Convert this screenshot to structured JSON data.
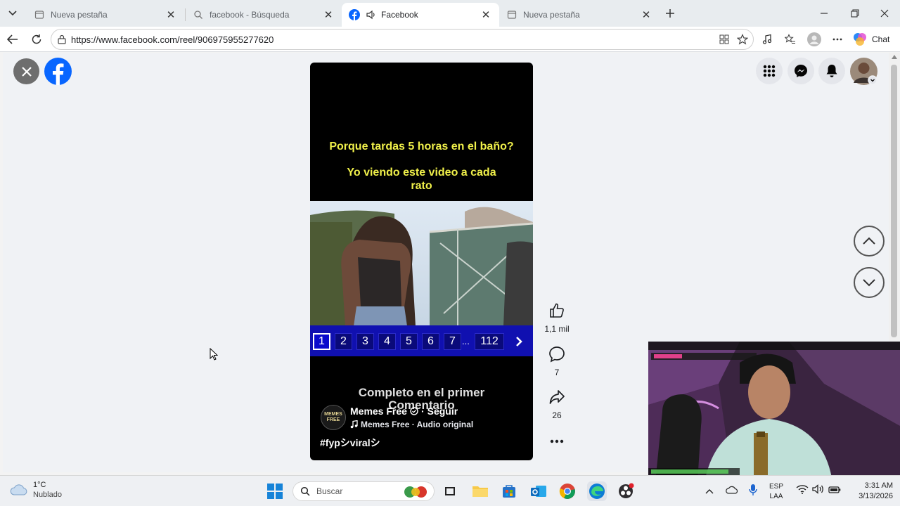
{
  "tabs": [
    {
      "label": "Nueva pestaña",
      "icon": "page-icon"
    },
    {
      "label": "facebook - Búsqueda",
      "icon": "search-icon"
    },
    {
      "label": "Facebook",
      "icon": "facebook-icon"
    },
    {
      "label": "Nueva pestaña",
      "icon": "page-icon"
    }
  ],
  "address": {
    "url": "https://www.facebook.com/reel/906975955277620"
  },
  "toolbar": {
    "chat_label": "Chat"
  },
  "reel": {
    "caption_line1": "Porque tardas 5 horas en el baño?",
    "caption_line2": "Yo viendo este video a cada",
    "caption_line3": "rato",
    "pages": [
      "1",
      "2",
      "3",
      "4",
      "5",
      "6",
      "7",
      "...",
      "112"
    ],
    "overlay_text_1": "Completo en el primer",
    "overlay_text_2": "Comentario",
    "author": "Memes Free",
    "follow_label": "Seguir",
    "audio": "Memes Free · Audio original",
    "hashtags": "#fypシviralシ",
    "avatar_text": "MEMES FREE"
  },
  "actions": {
    "likes": "1,1 mil",
    "comments": "7",
    "shares": "26"
  },
  "taskbar": {
    "weather_temp": "1°C",
    "weather_desc": "Nublado",
    "search_placeholder": "Buscar",
    "lang_line1": "ESP",
    "lang_line2": "LAA",
    "time": "3:31 AM",
    "date": "3/13/2026"
  },
  "colors": {
    "facebook_blue": "#0866ff",
    "caption_yellow": "#f0f04a",
    "pagination_blue": "#1010b0"
  }
}
